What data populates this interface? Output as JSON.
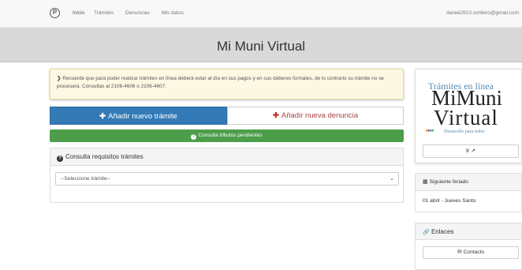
{
  "nav": {
    "logo": "P",
    "items": [
      "Inicio",
      "Trámites",
      "Denuncias",
      "Mis datos"
    ],
    "email": "daniel2610.cordero@gmail.com"
  },
  "hero": {
    "title": "Mi Muni Virtual"
  },
  "alert": {
    "icon": "chevron-right-icon",
    "text": "Recuerde que para poder realizar trámites en línea deberá estar al día en sus pagos y en sus deberes formales, de lo contrario su trámite no se procesará. Consultas al 2106-4606 o 2106-4607."
  },
  "actions": {
    "add_tramite": "Añadir nuevo trámite",
    "add_denuncia": "Añadir nueva denuncia",
    "tributos": "Consulta tributos pendientes"
  },
  "requisitos": {
    "heading": "Consulta requisitos trámites",
    "select_value": "--Seleccione trámite--"
  },
  "sidebar": {
    "banner": {
      "line1": "Trámites en línea",
      "line2": "MiMuni",
      "line3": "Virtual",
      "tagline": "Desarrollo para todos"
    },
    "ir_label": "Ir",
    "feriado": {
      "heading": "Siguiente feriado",
      "value": "01 abril - Jueves Santo"
    },
    "enlaces": {
      "heading": "Enlaces",
      "contacto": "Contacto"
    }
  },
  "colors": {
    "primary": "#337ab7",
    "danger": "#a94442",
    "success": "#4d9e4b",
    "warning_bg": "#fcf8e3"
  }
}
